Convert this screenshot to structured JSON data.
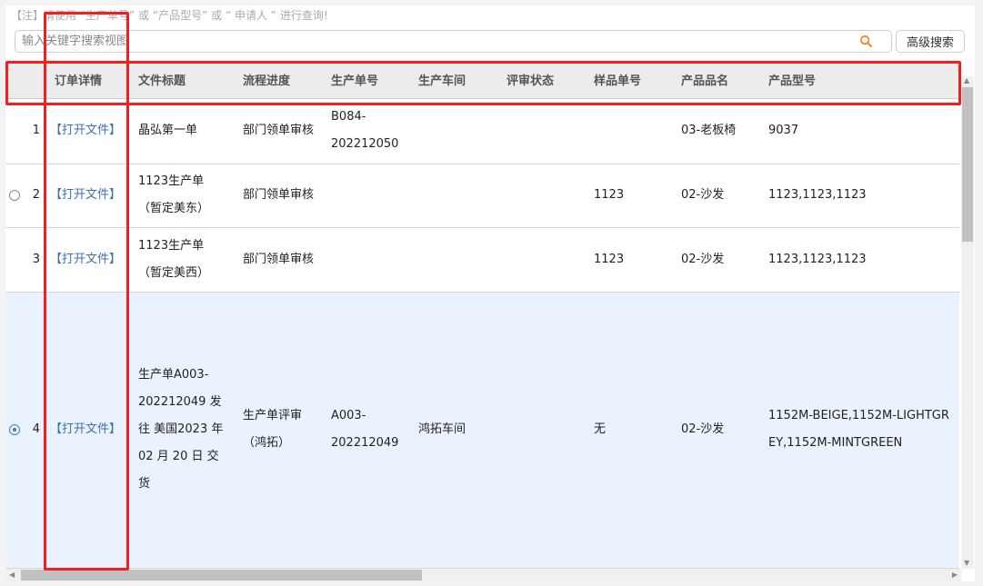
{
  "note": "【注】请使用 “生产单号” 或 “产品型号” 或 “ 申请人 ” 进行查询!",
  "search": {
    "placeholder": "输入关键字搜索视图",
    "value": "",
    "icon": "search-icon",
    "icon_color": "#f08a24"
  },
  "advanced_search_label": "高级搜索",
  "columns": [
    "",
    "订单详情",
    "文件标题",
    "流程进度",
    "生产单号",
    "生产车间",
    "评审状态",
    "样品单号",
    "产品品名",
    "产品型号"
  ],
  "rows": [
    {
      "num": "1",
      "radio": "none",
      "open": "【打开文件】",
      "title": "晶弘第一单",
      "progress": "部门领单审核",
      "order_no": "B084-202212050",
      "workshop": "",
      "review": "",
      "sample_no": "",
      "product_name": "03-老板椅",
      "model": "9037"
    },
    {
      "num": "2",
      "radio": "empty",
      "open": "【打开文件】",
      "title": "1123生产单（暂定美东）",
      "progress": "部门领单审核",
      "order_no": "",
      "workshop": "",
      "review": "",
      "sample_no": "1123",
      "product_name": "02-沙发",
      "model": "1123,1123,1123"
    },
    {
      "num": "3",
      "radio": "none",
      "open": "【打开文件】",
      "title": "1123生产单（暂定美西）",
      "progress": "部门领单审核",
      "order_no": "",
      "workshop": "",
      "review": "",
      "sample_no": "1123",
      "product_name": "02-沙发",
      "model": "1123,1123,1123"
    },
    {
      "num": "4",
      "radio": "selected",
      "open": "【打开文件】",
      "title": "生产单A003-202212049 发往 美国2023 年 02 月 20 日 交货",
      "progress": "生产单评审（鸿拓）",
      "order_no": "A003-202212049",
      "workshop": "鸿拓车间",
      "review": "",
      "sample_no": "无",
      "product_name": "02-沙发",
      "model": "1152M-BEIGE,1152M-LIGHTGREY,1152M-MINTGREEN"
    }
  ],
  "colors": {
    "link": "#3a6fb0",
    "selected_row": "#eaf3fd",
    "annotation": "#f02020",
    "header_bg": "#ececec"
  }
}
